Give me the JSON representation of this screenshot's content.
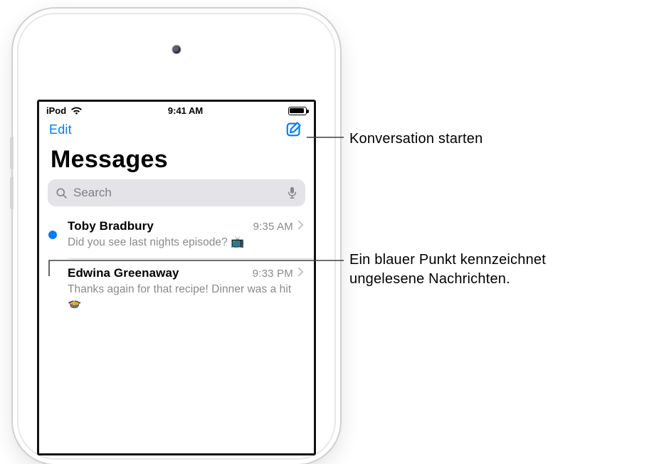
{
  "status_bar": {
    "carrier": "iPod",
    "time": "9:41 AM"
  },
  "nav": {
    "edit_label": "Edit"
  },
  "header": {
    "title": "Messages"
  },
  "search": {
    "placeholder": "Search"
  },
  "conversations": [
    {
      "name": "Toby Bradbury",
      "time": "9:35 AM",
      "preview": "Did you see last nights episode? 📺",
      "unread": true
    },
    {
      "name": "Edwina Greenaway",
      "time": "9:33 PM",
      "preview": "Thanks again for that recipe! Dinner was a hit 🍲",
      "unread": false
    }
  ],
  "callouts": {
    "compose": "Konversation starten",
    "unread": "Ein blauer Punkt kennzeichnet ungelesene Nachrichten."
  }
}
